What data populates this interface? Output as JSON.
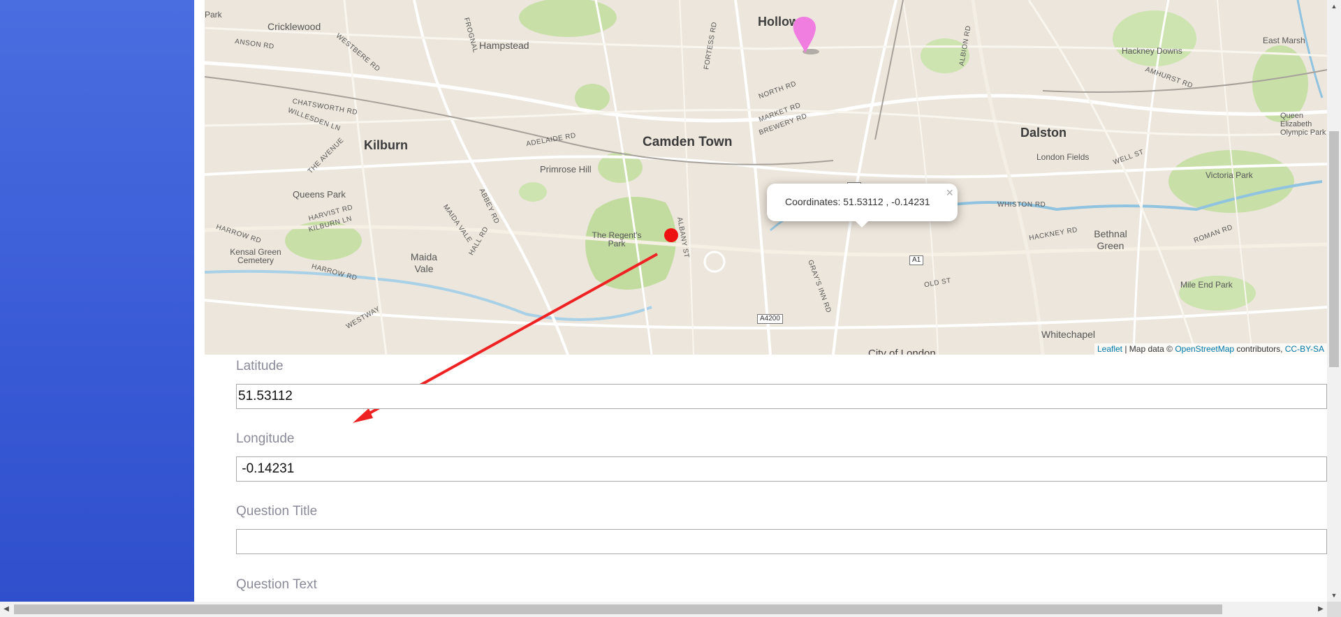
{
  "map": {
    "labels": {
      "park_tl": "Park",
      "cricklewood": "Cricklewood",
      "hampstead": "Hampstead",
      "holloway": "Hollow",
      "east_marsh": "East Marsh",
      "hackney_downs": "Hackney Downs",
      "kilburn": "Kilburn",
      "camden_town": "Camden Town",
      "dalston": "Dalston",
      "primrose_hill": "Primrose Hill",
      "london_fields": "London Fields",
      "queen_elizabeth": "Queen Elizabeth Olympic Park",
      "victoria_park": "Victoria Park",
      "queens_park": "Queens Park",
      "regents_park": "The Regent's Park",
      "kensal_green": "Kensal Green Cemetery",
      "maida_vale": "Maida Vale",
      "bethnal_green": "Bethnal Green",
      "mile_end_park": "Mile End Park",
      "whitechapel": "Whitechapel",
      "city_of_london": "City of London"
    },
    "roads": {
      "anson": "ANSON RD",
      "westbere": "WESTBERE RD",
      "frognal": "FROGNAL",
      "fortess": "FORTESS RD",
      "albion": "ALBION RD",
      "amhurst": "AMHURST RD",
      "chatsworth": "CHATSWORTH RD",
      "willesden": "WILLESDEN LN",
      "north_rd": "NORTH RD",
      "market_rd": "MARKET RD",
      "brewery_rd": "BREWERY RD",
      "adelaide": "ADELAIDE RD",
      "the_avenue": "THE AVENUE",
      "well_st": "WELL ST",
      "abbey": "ABBEY RD",
      "whiston": "WHISTON RD",
      "harvist": "HARVIST RD",
      "kilburn_ln": "KILBURN LN",
      "maida_vale_rd": "MAIDA VALE",
      "hall_rd": "HALL RD",
      "albany": "ALBANY ST",
      "hackney_rd": "HACKNEY RD",
      "roman": "ROMAN RD",
      "harrow": "HARROW RD",
      "harrow2": "HARROW RD",
      "westway": "WESTWAY",
      "old_st": "OLD ST",
      "grays_inn": "GRAY'S INN RD"
    },
    "shields": {
      "a1_top": "A1",
      "a1_bottom": "A1",
      "a4200": "A4200"
    },
    "popup": {
      "text": "Coordinates: 51.53112 , -0.14231",
      "close": "×"
    },
    "attribution": {
      "leaflet": "Leaflet",
      "sep": " | Map data © ",
      "osm": "OpenStreetMap",
      "contrib": " contributors, ",
      "license": "CC-BY-SA"
    },
    "marker_colors": {
      "selected": "#ee1111",
      "pin": "#f07ee0"
    }
  },
  "form": {
    "latitude": {
      "label": "Latitude",
      "value": "51.53112"
    },
    "longitude": {
      "label": "Longitude",
      "value": " -0.14231"
    },
    "question_title": {
      "label": "Question Title",
      "value": ""
    },
    "question_text": {
      "label": "Question Text"
    }
  },
  "scrollbars": {
    "up": "▲",
    "down": "▼",
    "left": "◀",
    "right": "▶"
  }
}
